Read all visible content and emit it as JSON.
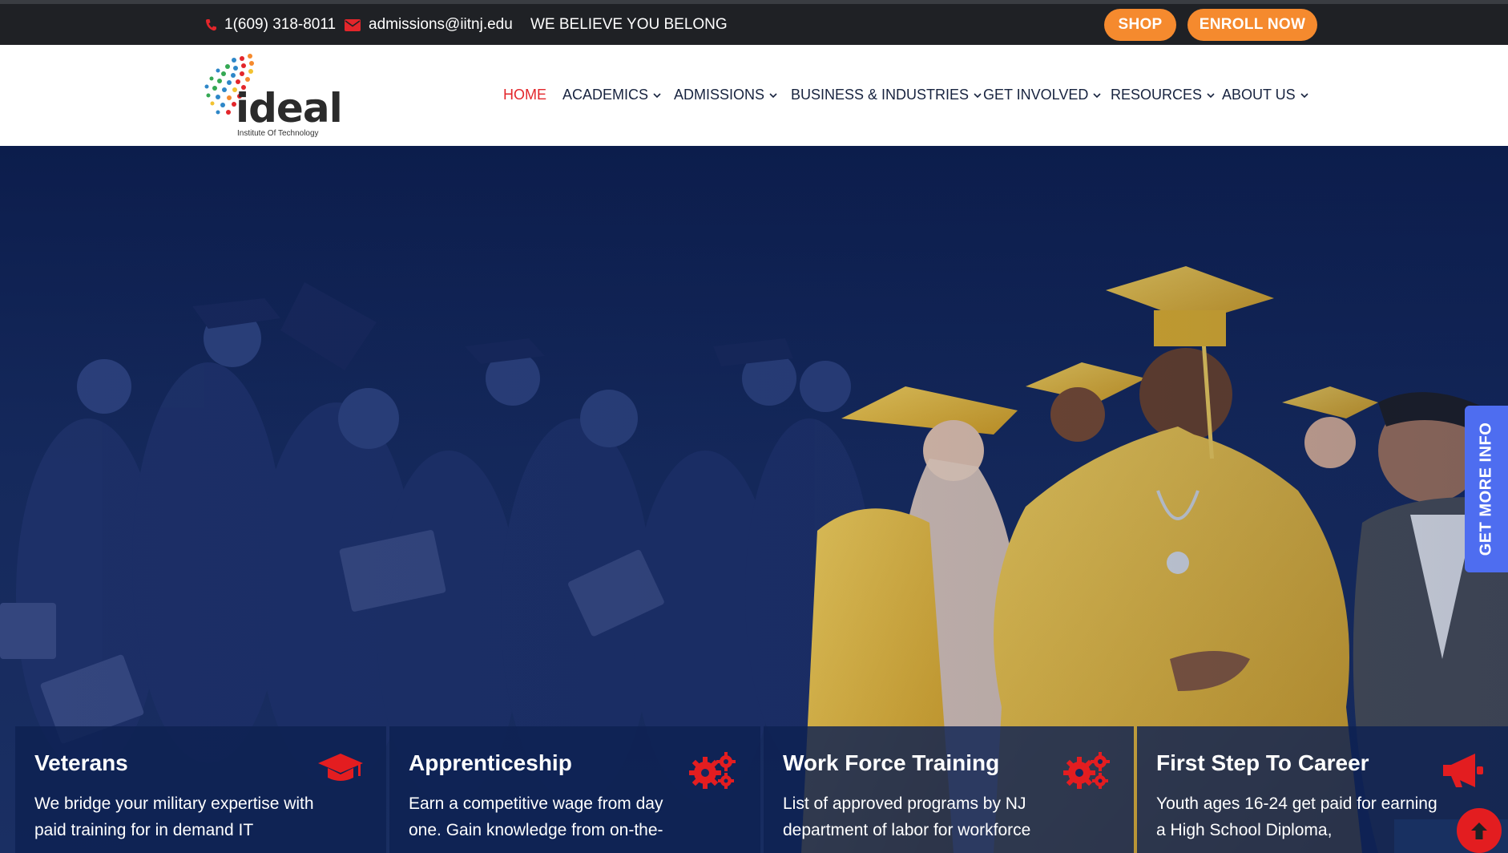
{
  "topbar": {
    "phone": "1(609) 318-8011",
    "email": "admissions@iitnj.edu",
    "tagline": "WE BELIEVE YOU BELONG",
    "shop_label": "SHOP",
    "enroll_label": "ENROLL NOW"
  },
  "logo": {
    "name": "ideal",
    "subtitle": "Institute Of Technology"
  },
  "nav": {
    "items": [
      {
        "label": "HOME",
        "active": true
      },
      {
        "label": "ACADEMICS",
        "has_dropdown": true
      },
      {
        "label": "ADMISSIONS",
        "has_dropdown": true
      },
      {
        "label": "BUSINESS & INDUSTRIES",
        "has_dropdown": true
      },
      {
        "label": "GET INVOLVED",
        "has_dropdown": true
      },
      {
        "label": "RESOURCES",
        "has_dropdown": true
      },
      {
        "label": "ABOUT US",
        "has_dropdown": true
      }
    ]
  },
  "side_tab": {
    "label": "GET MORE INFO"
  },
  "cards": [
    {
      "title": "Veterans",
      "text": "We bridge your military expertise with paid training for in demand IT",
      "icon": "graduation-cap-icon"
    },
    {
      "title": "Apprenticeship",
      "text": "Earn a competitive wage from day one. Gain knowledge from on-the-",
      "icon": "gears-icon"
    },
    {
      "title": "Work Force Training",
      "text": "List of approved programs by NJ department of labor for workforce",
      "icon": "gears-icon"
    },
    {
      "title": "First Step To Career",
      "text": "Youth ages 16-24 get paid for earning a High School Diploma,",
      "icon": "megaphone-icon"
    }
  ],
  "colors": {
    "topbar_bg": "#1f2125",
    "accent_orange": "#f58a2e",
    "nav_text": "#17233f",
    "active_red": "#e3262b",
    "hero_navy": "#0c1d4c",
    "side_tab_blue": "#4e6df0",
    "icon_red": "#e31d20",
    "gown_gold": "#f2c230"
  }
}
